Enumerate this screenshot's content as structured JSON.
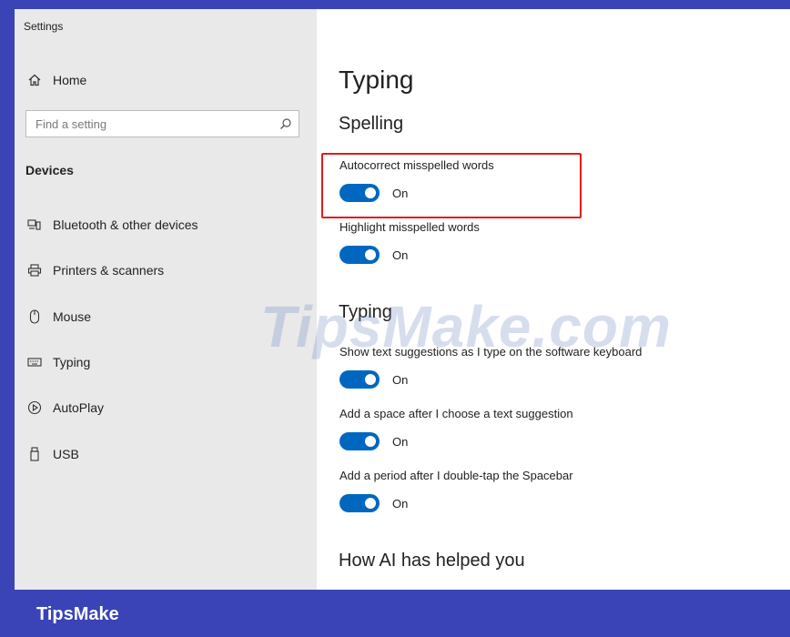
{
  "window": {
    "title": "Settings"
  },
  "sidebar": {
    "home_label": "Home",
    "search": {
      "placeholder": "Find a setting"
    },
    "section_label": "Devices",
    "items": [
      {
        "label": "Bluetooth & other devices",
        "icon": "bluetooth-devices-icon"
      },
      {
        "label": "Printers & scanners",
        "icon": "printer-icon"
      },
      {
        "label": "Mouse",
        "icon": "mouse-icon"
      },
      {
        "label": "Typing",
        "icon": "keyboard-icon"
      },
      {
        "label": "AutoPlay",
        "icon": "autoplay-icon"
      },
      {
        "label": "USB",
        "icon": "usb-icon"
      }
    ]
  },
  "main": {
    "title": "Typing",
    "spelling": {
      "heading": "Spelling",
      "settings": [
        {
          "label": "Autocorrect misspelled words",
          "state": "On"
        },
        {
          "label": "Highlight misspelled words",
          "state": "On"
        }
      ]
    },
    "typing": {
      "heading": "Typing",
      "settings": [
        {
          "label": "Show text suggestions as I type on the software keyboard",
          "state": "On"
        },
        {
          "label": "Add a space after I choose a text suggestion",
          "state": "On"
        },
        {
          "label": "Add a period after I double-tap the Spacebar",
          "state": "On"
        }
      ]
    },
    "ai_heading": "How AI has helped you"
  },
  "watermark": "TipsMake.com",
  "brand": "TipsMake",
  "colors": {
    "accent": "#0067c0",
    "highlight": "#e21b1b",
    "brand_bar": "#3a44b6",
    "sidebar_bg": "#e9e9e9"
  }
}
